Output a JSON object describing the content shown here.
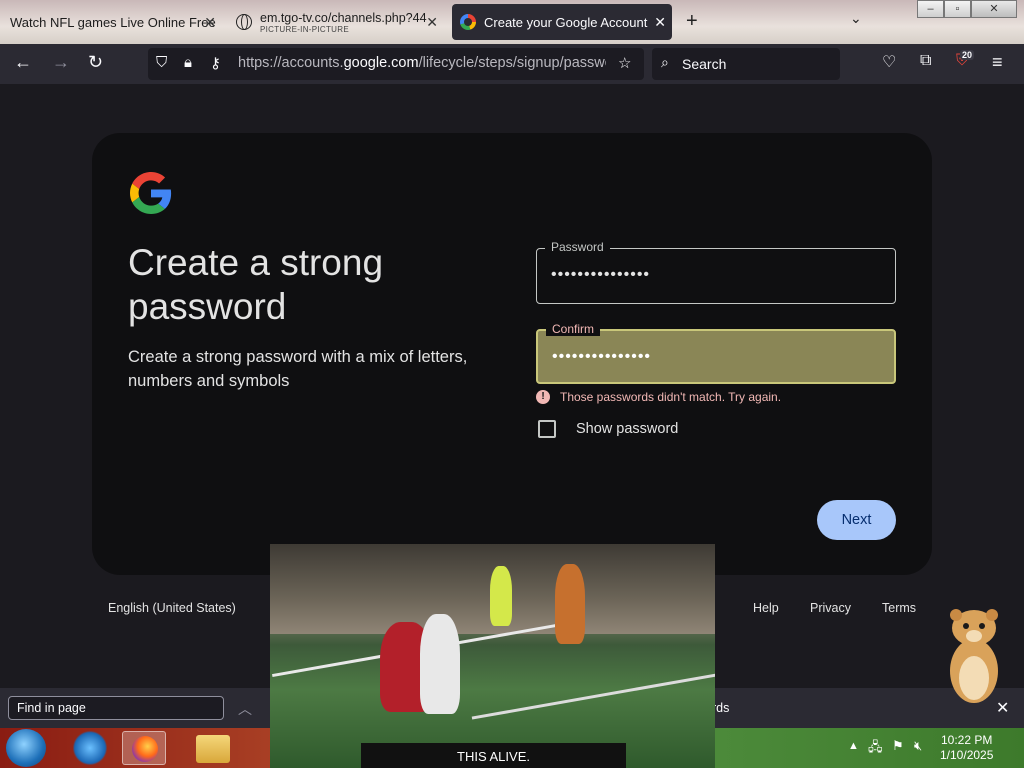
{
  "browser": {
    "tabs": [
      {
        "title": "Watch NFL games Live Online Free",
        "close": "✕"
      },
      {
        "title": "em.tgo-tv.co/channels.php?44",
        "subtitle": "PICTURE-IN-PICTURE",
        "close": "✕"
      },
      {
        "title": "Create your Google Account",
        "close": "✕",
        "active": true
      }
    ],
    "new_tab": "+",
    "list_tabs": "⌄",
    "window_buttons": {
      "minimize": "–",
      "maximize": "▫",
      "close": "✕"
    },
    "url": {
      "prefix": "https://accounts.",
      "domain": "google.com",
      "suffix": "/lifecycle/steps/signup/password"
    },
    "search_placeholder": "Search",
    "extensions_badge": "20"
  },
  "page": {
    "heading": "Create a strong password",
    "subheading": "Create a strong password with a mix of letters, numbers and symbols",
    "password_label": "Password",
    "password_value": "•••••••••••••••",
    "confirm_label": "Confirm",
    "confirm_value": "•••••••••••••••",
    "error_text": "Those passwords didn't match. Try again.",
    "error_icon": "!",
    "show_password_label": "Show password",
    "next_label": "Next",
    "footer": {
      "language": "English (United States)",
      "help": "Help",
      "privacy": "Privacy",
      "terms": "Terms"
    }
  },
  "find_bar": {
    "placeholder": "Find in page",
    "partial_text": "rds"
  },
  "pip_video": {
    "caption": "THIS ALIVE."
  },
  "taskbar": {
    "time": "10:22 PM",
    "date": "1/10/2025"
  },
  "colors": {
    "background": "#1b1a1f",
    "card": "#0f0f11",
    "accent": "#a8c7fa",
    "error": "#f2b8b5",
    "autofill": "#8a8656"
  }
}
